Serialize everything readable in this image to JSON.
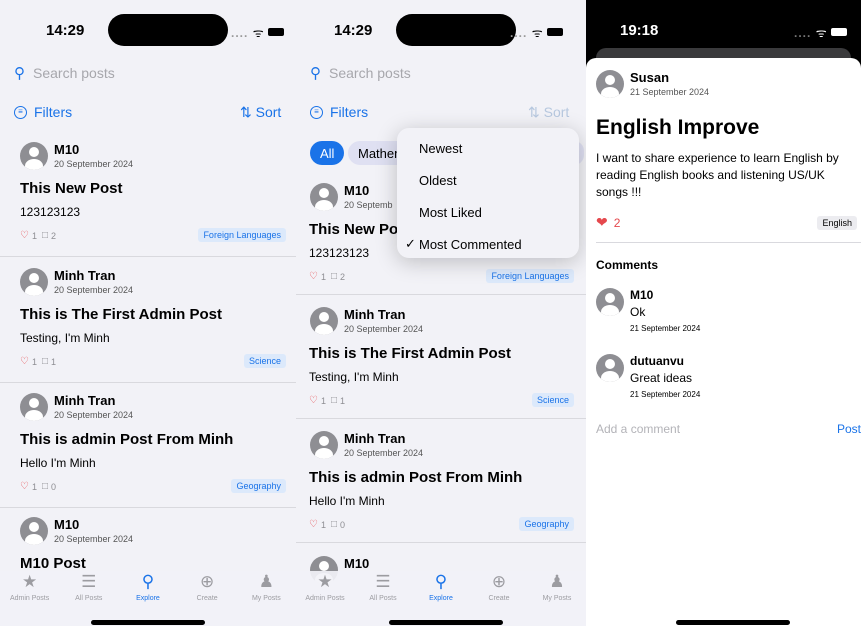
{
  "screen1": {
    "time": "14:29",
    "search_placeholder": "Search posts",
    "filters_label": "Filters",
    "sort_label": "Sort",
    "posts": [
      {
        "user": "M10",
        "date": "20 September 2024",
        "title": "This New Post",
        "body": "123123123",
        "likes": "1",
        "comments": "2",
        "tag": "Foreign Languages"
      },
      {
        "user": "Minh Tran",
        "date": "20 September 2024",
        "title": "This is The First Admin Post",
        "body": "Testing, I'm Minh",
        "likes": "1",
        "comments": "1",
        "tag": "Science"
      },
      {
        "user": "Minh Tran",
        "date": "20 September 2024",
        "title": "This is admin Post From Minh",
        "body": "Hello I'm Minh",
        "likes": "1",
        "comments": "0",
        "tag": "Geography"
      },
      {
        "user": "M10",
        "date": "20 September 2024",
        "title": "M10 Post"
      }
    ]
  },
  "screen2": {
    "time": "14:29",
    "search_placeholder": "Search posts",
    "filters_label": "Filters",
    "sort_label": "Sort",
    "chips": [
      "All",
      "Mathem"
    ],
    "sort_options": [
      "Newest",
      "Oldest",
      "Most Liked",
      "Most Commented"
    ],
    "selected_sort_check": "✓",
    "posts": [
      {
        "user": "M10",
        "date": "20 Septemb",
        "title": "This New Pos",
        "body": "123123123",
        "likes": "1",
        "comments": "2",
        "tag": "Foreign Languages"
      },
      {
        "user": "Minh Tran",
        "date": "20 September 2024",
        "title": "This is The First Admin Post",
        "body": "Testing, I'm Minh",
        "likes": "1",
        "comments": "1",
        "tag": "Science"
      },
      {
        "user": "Minh Tran",
        "date": "20 September 2024",
        "title": "This is admin Post From Minh",
        "body": "Hello I'm Minh",
        "likes": "1",
        "comments": "0",
        "tag": "Geography"
      },
      {
        "user": "M10"
      }
    ]
  },
  "tabs": [
    {
      "label": "Admin Posts",
      "icon": "star-icon"
    },
    {
      "label": "All Posts",
      "icon": "list-icon"
    },
    {
      "label": "Explore",
      "icon": "search-icon"
    },
    {
      "label": "Create",
      "icon": "plus-circle-icon"
    },
    {
      "label": "My Posts",
      "icon": "person-icon"
    }
  ],
  "screen3": {
    "time": "19:18",
    "author": "Susan",
    "date": "21 September 2024",
    "title": "English Improve",
    "body": "I want to share experience to learn English by reading English books and listening US/UK songs !!!",
    "likes": "2",
    "tag": "English",
    "comments_heading": "Comments",
    "comments": [
      {
        "user": "M10",
        "text": "Ok",
        "date": "21 September 2024"
      },
      {
        "user": "dutuanvu",
        "text": "Great ideas",
        "date": "21 September 2024"
      }
    ],
    "add_comment_placeholder": "Add a comment",
    "post_label": "Post"
  },
  "colors": {
    "accent": "#1a73e8",
    "like": "#e5484d",
    "tag_bg": "#dce9fb"
  }
}
